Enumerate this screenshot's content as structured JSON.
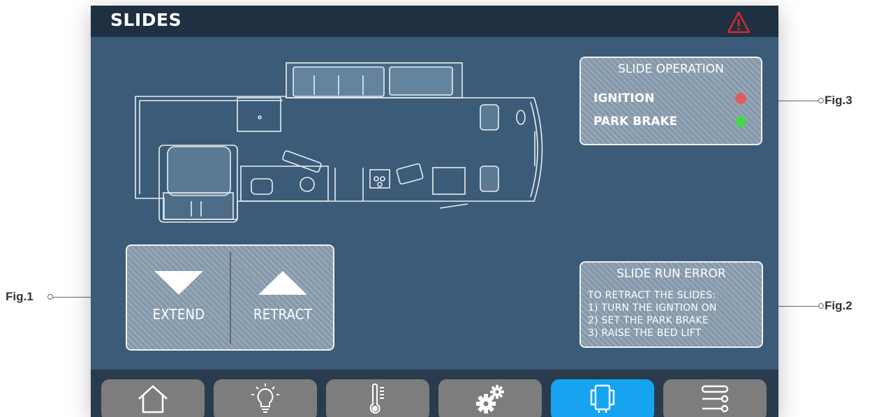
{
  "header": {
    "title": "SLIDES",
    "alert_icon": "warning-triangle-icon",
    "alert_color": "#d42a2a"
  },
  "controls": {
    "extend_label": "EXTEND",
    "retract_label": "RETRACT"
  },
  "slide_operation": {
    "title": "SLIDE OPERATION",
    "items": [
      {
        "label": "IGNITION",
        "status_color": "#e05c5c"
      },
      {
        "label": "PARK BRAKE",
        "status_color": "#46d64a"
      }
    ]
  },
  "slide_error": {
    "title": "SLIDE RUN ERROR",
    "lines": [
      "TO RETRACT THE SLIDES:",
      "1) TURN THE IGNTION ON",
      "2) SET THE PARK BRAKE",
      "3) RAISE THE BED LIFT"
    ]
  },
  "nav": {
    "tabs": [
      {
        "icon": "home-icon"
      },
      {
        "icon": "light-bulb-icon"
      },
      {
        "icon": "thermometer-icon"
      },
      {
        "icon": "gears-icon"
      },
      {
        "icon": "slides-icon",
        "active": true
      },
      {
        "icon": "settings-sliders-icon"
      }
    ]
  },
  "annotations": {
    "fig1": "Fig.1",
    "fig2": "Fig.2",
    "fig3": "Fig.3"
  },
  "colors": {
    "screen_bg": "#3b5b78",
    "topbar_bg": "#1f3042",
    "nav_bg": "#2a3b4d",
    "tab_bg": "#7d7d7d",
    "tab_active_bg": "#16a3f0"
  }
}
